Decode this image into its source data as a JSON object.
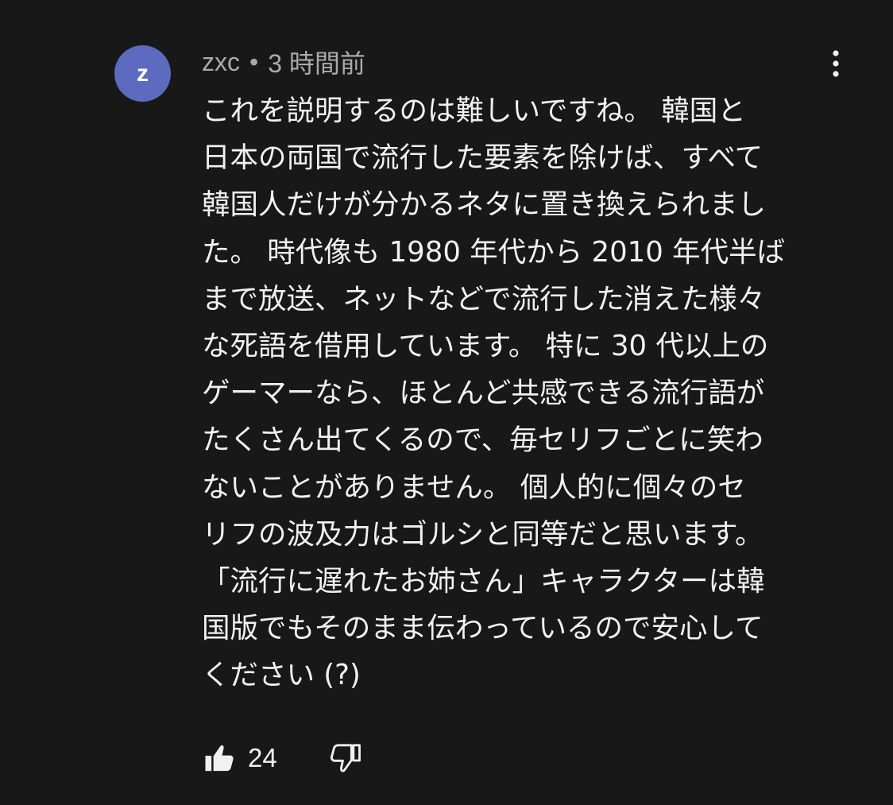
{
  "comment": {
    "avatar_letter": "z",
    "avatar_color": "#5c6bc0",
    "author": "zxc",
    "separator": "•",
    "timestamp": "3 時間前",
    "menu_icon": "more-vert-icon",
    "text_lines": [
      "これを説明するのは難しいですね。 韓国と",
      "日本の両国で流行した要素を除けば、すべて",
      "韓国人だけが分かるネタに置き換えられまし",
      "た。 時代像も 1980 年代から 2010 年代半ば",
      "まで放送、ネットなどで流行した消えた様々",
      "な死語を借用しています。 特に 30 代以上の",
      "ゲーマーなら、ほとんど共感できる流行語が",
      "たくさん出てくるので、毎セリフごとに笑わ",
      "ないことがありません。 個人的に個々のセ",
      "リフの波及力はゴルシと同等だと思います。",
      "「流行に遅れたお姉さん」キャラクターは韓",
      "国版でもそのまま伝わっているので安心して",
      "ください (?)"
    ],
    "like_icon": "thumbs-up-icon",
    "like_count": "24",
    "dislike_icon": "thumbs-down-icon"
  },
  "colors": {
    "background": "#181818",
    "text": "#f1f1f1",
    "meta_text": "#aaaaaa"
  }
}
